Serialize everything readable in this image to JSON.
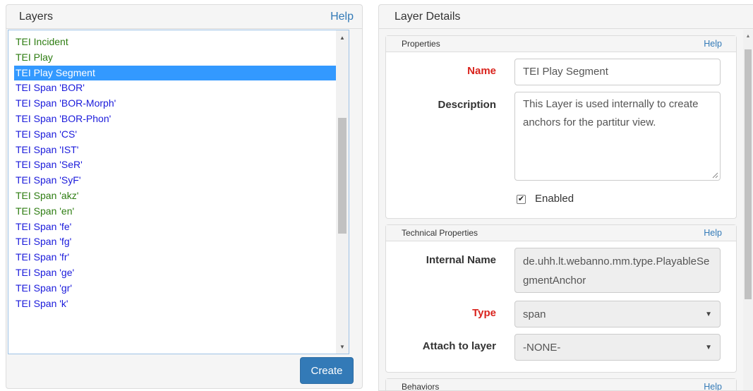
{
  "layers_panel": {
    "title": "Layers",
    "help": "Help",
    "items": [
      {
        "label": "TEI Incident",
        "color": "green"
      },
      {
        "label": "TEI Play",
        "color": "green"
      },
      {
        "label": "TEI Play Segment",
        "color": "selected"
      },
      {
        "label": "TEI Span 'BOR'",
        "color": "blue"
      },
      {
        "label": "TEI Span 'BOR-Morph'",
        "color": "blue"
      },
      {
        "label": "TEI Span 'BOR-Phon'",
        "color": "blue"
      },
      {
        "label": "TEI Span 'CS'",
        "color": "blue"
      },
      {
        "label": "TEI Span 'IST'",
        "color": "blue"
      },
      {
        "label": "TEI Span 'SeR'",
        "color": "blue"
      },
      {
        "label": "TEI Span 'SyF'",
        "color": "blue"
      },
      {
        "label": "TEI Span 'akz'",
        "color": "green"
      },
      {
        "label": "TEI Span 'en'",
        "color": "green"
      },
      {
        "label": "TEI Span 'fe'",
        "color": "blue"
      },
      {
        "label": "TEI Span 'fg'",
        "color": "blue"
      },
      {
        "label": "TEI Span 'fr'",
        "color": "blue"
      },
      {
        "label": "TEI Span 'ge'",
        "color": "blue"
      },
      {
        "label": "TEI Span 'gr'",
        "color": "blue"
      },
      {
        "label": "TEI Span 'k'",
        "color": "blue"
      }
    ],
    "create_label": "Create"
  },
  "details_panel": {
    "title": "Layer Details",
    "properties": {
      "title": "Properties",
      "help": "Help",
      "name_label": "Name",
      "name_value": "TEI Play Segment",
      "description_label": "Description",
      "description_value": "This Layer is used internally to create anchors for the partitur view.",
      "enabled_label": "Enabled",
      "enabled_checked": true
    },
    "technical": {
      "title": "Technical Properties",
      "help": "Help",
      "internal_name_label": "Internal Name",
      "internal_name_value": "de.uhh.lt.webanno.mm.type.PlayableSegmentAnchor",
      "type_label": "Type",
      "type_value": "span",
      "attach_label": "Attach to layer",
      "attach_value": "-NONE-"
    },
    "behaviors": {
      "title": "Behaviors",
      "help": "Help"
    }
  },
  "colors": {
    "link": "#337ab7",
    "selected_bg": "#3399ff",
    "green_item": "#2e7d12",
    "blue_item": "#1a1adb",
    "required": "#d9231d"
  }
}
